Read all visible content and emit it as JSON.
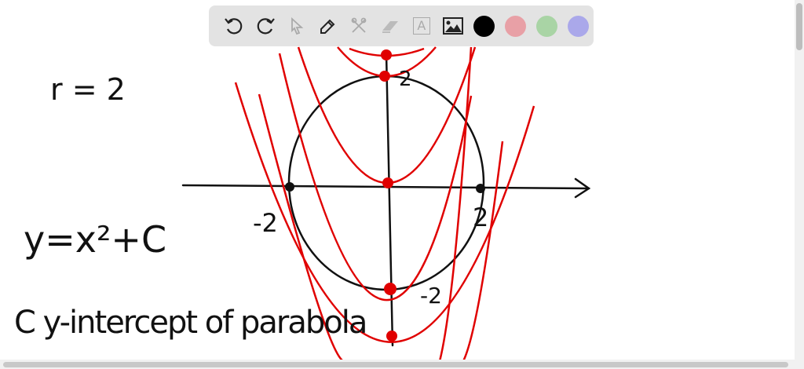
{
  "toolbar": {
    "tools": [
      {
        "name": "undo-icon",
        "enabled": true
      },
      {
        "name": "redo-icon",
        "enabled": true
      },
      {
        "name": "select-icon",
        "enabled": false
      },
      {
        "name": "pen-icon",
        "enabled": true
      },
      {
        "name": "tools-icon",
        "enabled": false
      },
      {
        "name": "eraser-icon",
        "enabled": false
      },
      {
        "name": "text-icon",
        "enabled": false
      },
      {
        "name": "image-icon",
        "enabled": true
      }
    ],
    "text_tool_glyph": "A",
    "colors": {
      "black": "#000000",
      "red": "#e8a0a6",
      "green": "#a9d4a5",
      "blue": "#aaa8ea"
    }
  },
  "ink": {
    "black": "#111111",
    "red": "#e00000"
  },
  "notes": {
    "radius": "r = 2",
    "equation": "y=x²+C",
    "caption": "C y-intercept of parabola",
    "label_top": "2",
    "label_left": "-2",
    "label_right": "2",
    "label_bottom": "-2"
  }
}
